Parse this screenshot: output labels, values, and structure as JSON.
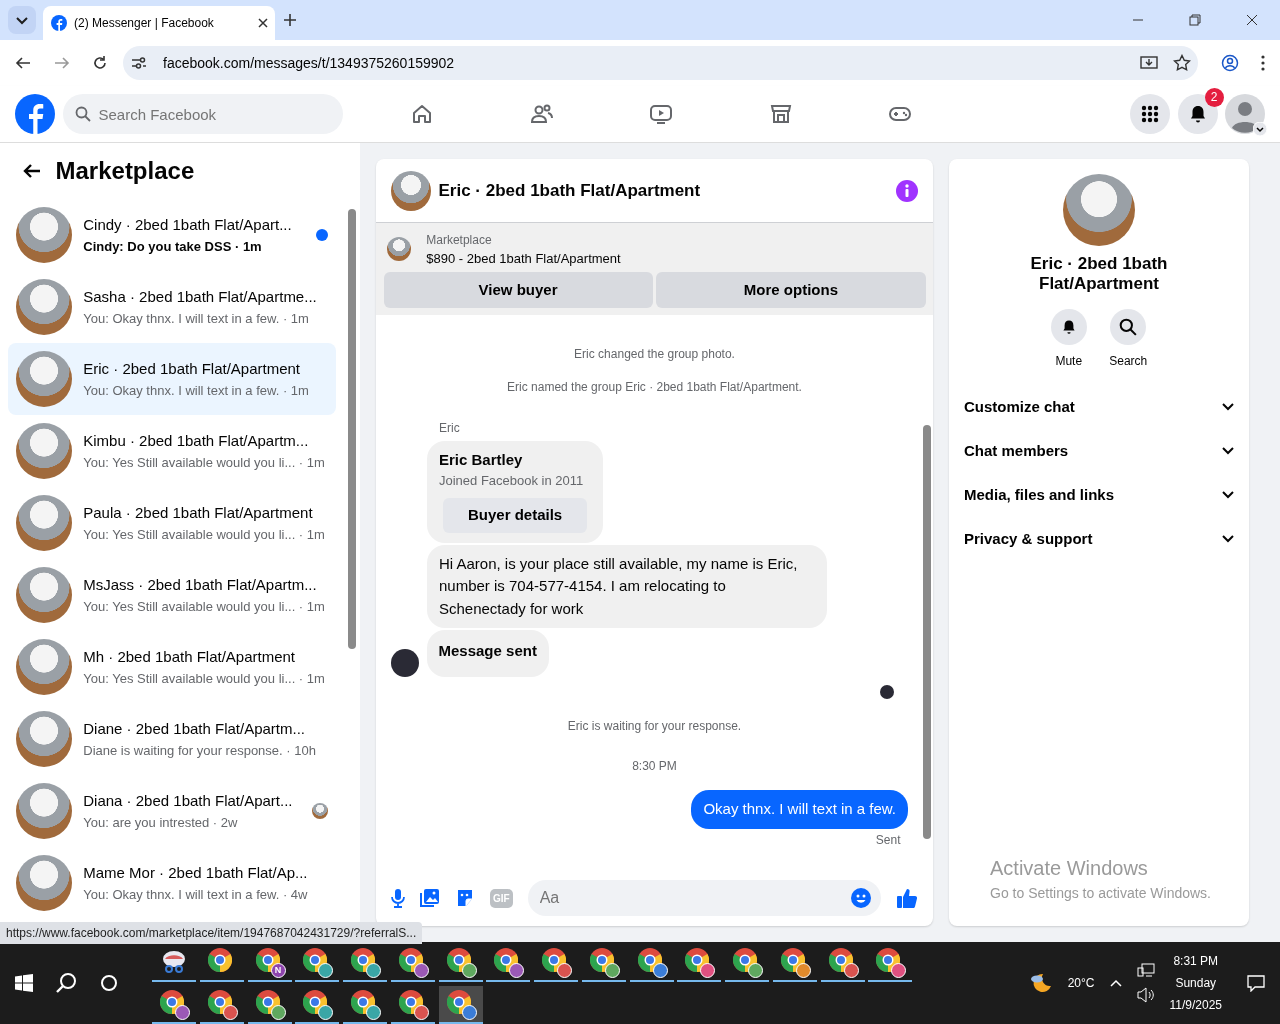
{
  "browser": {
    "tab_title": "(2) Messenger | Facebook",
    "url": "facebook.com/messages/t/1349375260159902",
    "status_url": "https://www.facebook.com/marketplace/item/1947687042431729/?referralS..."
  },
  "topbar": {
    "search_placeholder": "Search Facebook",
    "notification_count": "2"
  },
  "sidebar": {
    "title": "Marketplace",
    "conversations": [
      {
        "title": "Cindy · 2bed 1bath Flat/Apart...",
        "preview": "Cindy: Do you take DSS",
        "time": "· 1m",
        "unread": true,
        "seen": false,
        "selected": false
      },
      {
        "title": "Sasha · 2bed 1bath Flat/Apartme...",
        "preview": "You: Okay thnx. I will text in a few.",
        "time": "· 1m",
        "unread": false,
        "seen": false,
        "selected": false
      },
      {
        "title": "Eric · 2bed 1bath Flat/Apartment",
        "preview": "You: Okay thnx. I will text in a few.",
        "time": "· 1m",
        "unread": false,
        "seen": false,
        "selected": true
      },
      {
        "title": "Kimbu · 2bed 1bath Flat/Apartm...",
        "preview": "You: Yes Still available would you li...",
        "time": "· 1m",
        "unread": false,
        "seen": false,
        "selected": false
      },
      {
        "title": "Paula · 2bed 1bath Flat/Apartment",
        "preview": "You: Yes Still available would you li...",
        "time": "· 1m",
        "unread": false,
        "seen": false,
        "selected": false
      },
      {
        "title": "MsJass · 2bed 1bath Flat/Apartm...",
        "preview": "You: Yes Still available would you li...",
        "time": "· 1m",
        "unread": false,
        "seen": false,
        "selected": false
      },
      {
        "title": "Mh · 2bed 1bath Flat/Apartment",
        "preview": "You: Yes Still available would you li...",
        "time": "· 1m",
        "unread": false,
        "seen": false,
        "selected": false
      },
      {
        "title": "Diane · 2bed 1bath Flat/Apartm...",
        "preview": "Diane is waiting for your response.",
        "time": "· 10h",
        "unread": false,
        "seen": false,
        "selected": false
      },
      {
        "title": "Diana · 2bed 1bath Flat/Apart...",
        "preview": "You: are you intrested",
        "time": "· 2w",
        "unread": false,
        "seen": true,
        "selected": false
      },
      {
        "title": "Mame Mor · 2bed 1bath Flat/Ap...",
        "preview": "You: Okay thnx. I will text in a few.",
        "time": "· 4w",
        "unread": false,
        "seen": false,
        "selected": false
      }
    ]
  },
  "chat": {
    "title": "Eric · 2bed 1bath Flat/Apartment",
    "listing": {
      "label": "Marketplace",
      "text": "$890 - 2bed 1bath Flat/Apartment"
    },
    "buttons": [
      "View buyer",
      "More options"
    ],
    "messages": [
      {
        "kind": "event",
        "text": "Eric changed the group photo."
      },
      {
        "kind": "event",
        "text": "Eric named the group Eric · 2bed 1bath Flat/Apartment."
      },
      {
        "kind": "sender",
        "text": "Eric"
      },
      {
        "kind": "profile",
        "name": "Eric Bartley",
        "text": "Joined Facebook in 2011",
        "button": "Buyer details"
      },
      {
        "kind": "incoming",
        "text": "Hi Aaron, is your place still available, my name is Eric, number is 704-577-4154. I am relocating to Schenectady for work"
      },
      {
        "kind": "incoming-bold",
        "text": "Message sent"
      },
      {
        "kind": "receipt"
      },
      {
        "kind": "event",
        "text": "Eric is waiting for your response."
      },
      {
        "kind": "timestamp",
        "text": "8:30 PM"
      },
      {
        "kind": "outgoing",
        "text": "Okay thnx. I will text in a few.",
        "status": "Sent"
      }
    ],
    "composer": {
      "placeholder": "Aa",
      "gif_label": "GIF"
    }
  },
  "details": {
    "title": "Eric · 2bed 1bath Flat/Apartment",
    "actions": [
      {
        "kind": "bell",
        "label": "Mute"
      },
      {
        "kind": "search",
        "label": "Search"
      }
    ],
    "sections": [
      {
        "label": "Customize chat",
        "expanded": false
      },
      {
        "label": "Chat members",
        "expanded": false
      },
      {
        "label": "Media, files and links",
        "expanded": false
      },
      {
        "label": "Privacy & support",
        "expanded": false
      }
    ]
  },
  "activation": {
    "title": "Activate Windows",
    "text": "Go to Settings to activate Windows."
  },
  "taskbar": {
    "apps": [
      {
        "kind": "snip",
        "selected": false
      },
      {
        "kind": "browser",
        "selected": false
      },
      {
        "kind": "profile",
        "color": "#8e44ad",
        "badge": "N",
        "selected": false
      },
      {
        "kind": "profile",
        "color": "#3aa6a6",
        "selected": false
      },
      {
        "kind": "profile",
        "color": "#3aa6a6",
        "selected": false
      },
      {
        "kind": "profile",
        "color": "#9b59b6",
        "selected": false
      },
      {
        "kind": "profile",
        "color": "#5fa85f",
        "selected": false
      },
      {
        "kind": "profile",
        "color": "#9b59b6",
        "selected": false
      },
      {
        "kind": "profile",
        "color": "#d9534f",
        "selected": false
      },
      {
        "kind": "profile",
        "color": "#5fa85f",
        "selected": false
      },
      {
        "kind": "profile",
        "color": "#3b7dd8",
        "selected": false
      },
      {
        "kind": "profile",
        "color": "#e05080",
        "selected": false
      },
      {
        "kind": "profile",
        "color": "#5fa85f",
        "selected": false
      },
      {
        "kind": "profile",
        "color": "#e08a2c",
        "selected": false
      },
      {
        "kind": "profile",
        "color": "#d9534f",
        "selected": false
      },
      {
        "kind": "profile",
        "color": "#e05080",
        "selected": false
      },
      {
        "kind": "profile",
        "color": "#9b59b6",
        "selected": false
      },
      {
        "kind": "profile",
        "color": "#d9534f",
        "selected": false
      },
      {
        "kind": "profile",
        "color": "#5fa85f",
        "selected": false
      },
      {
        "kind": "profile",
        "color": "#3aa6a6",
        "selected": false
      },
      {
        "kind": "profile",
        "color": "#3aa6a6",
        "selected": false
      },
      {
        "kind": "profile",
        "color": "#d9534f",
        "selected": false
      },
      {
        "kind": "profile",
        "color": "#3b7dd8",
        "selected": true
      }
    ],
    "temperature": "20°C",
    "time": "8:31 PM",
    "day": "Sunday",
    "date": "11/9/2025"
  }
}
